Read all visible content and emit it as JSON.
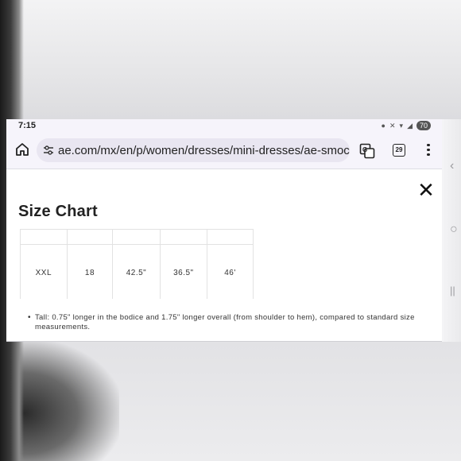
{
  "status_bar": {
    "time": "7:15",
    "battery": "70"
  },
  "browser": {
    "url": "ae.com/mx/en/p/women/dresses/mini-dresses/ae-smocke",
    "tab_count": "29"
  },
  "size_chart": {
    "title": "Size Chart",
    "row": [
      "XXL",
      "18",
      "42.5\"",
      "36.5\"",
      "46'"
    ],
    "note": "Tall: 0.75\" longer in the bodice and 1.75\" longer overall (from shoulder to hem), compared to standard size measurements."
  },
  "colors": {
    "browser_chrome": "#f6f4fb",
    "url_pill": "#e9e6f1",
    "text": "#222222",
    "table_border": "#e2e2e2"
  },
  "icons": {
    "home": "home-icon",
    "tune": "tune-icon",
    "translate": "translate-icon",
    "tabs": "tab-switcher-icon",
    "menu": "more-vert-icon",
    "close": "close-icon"
  }
}
